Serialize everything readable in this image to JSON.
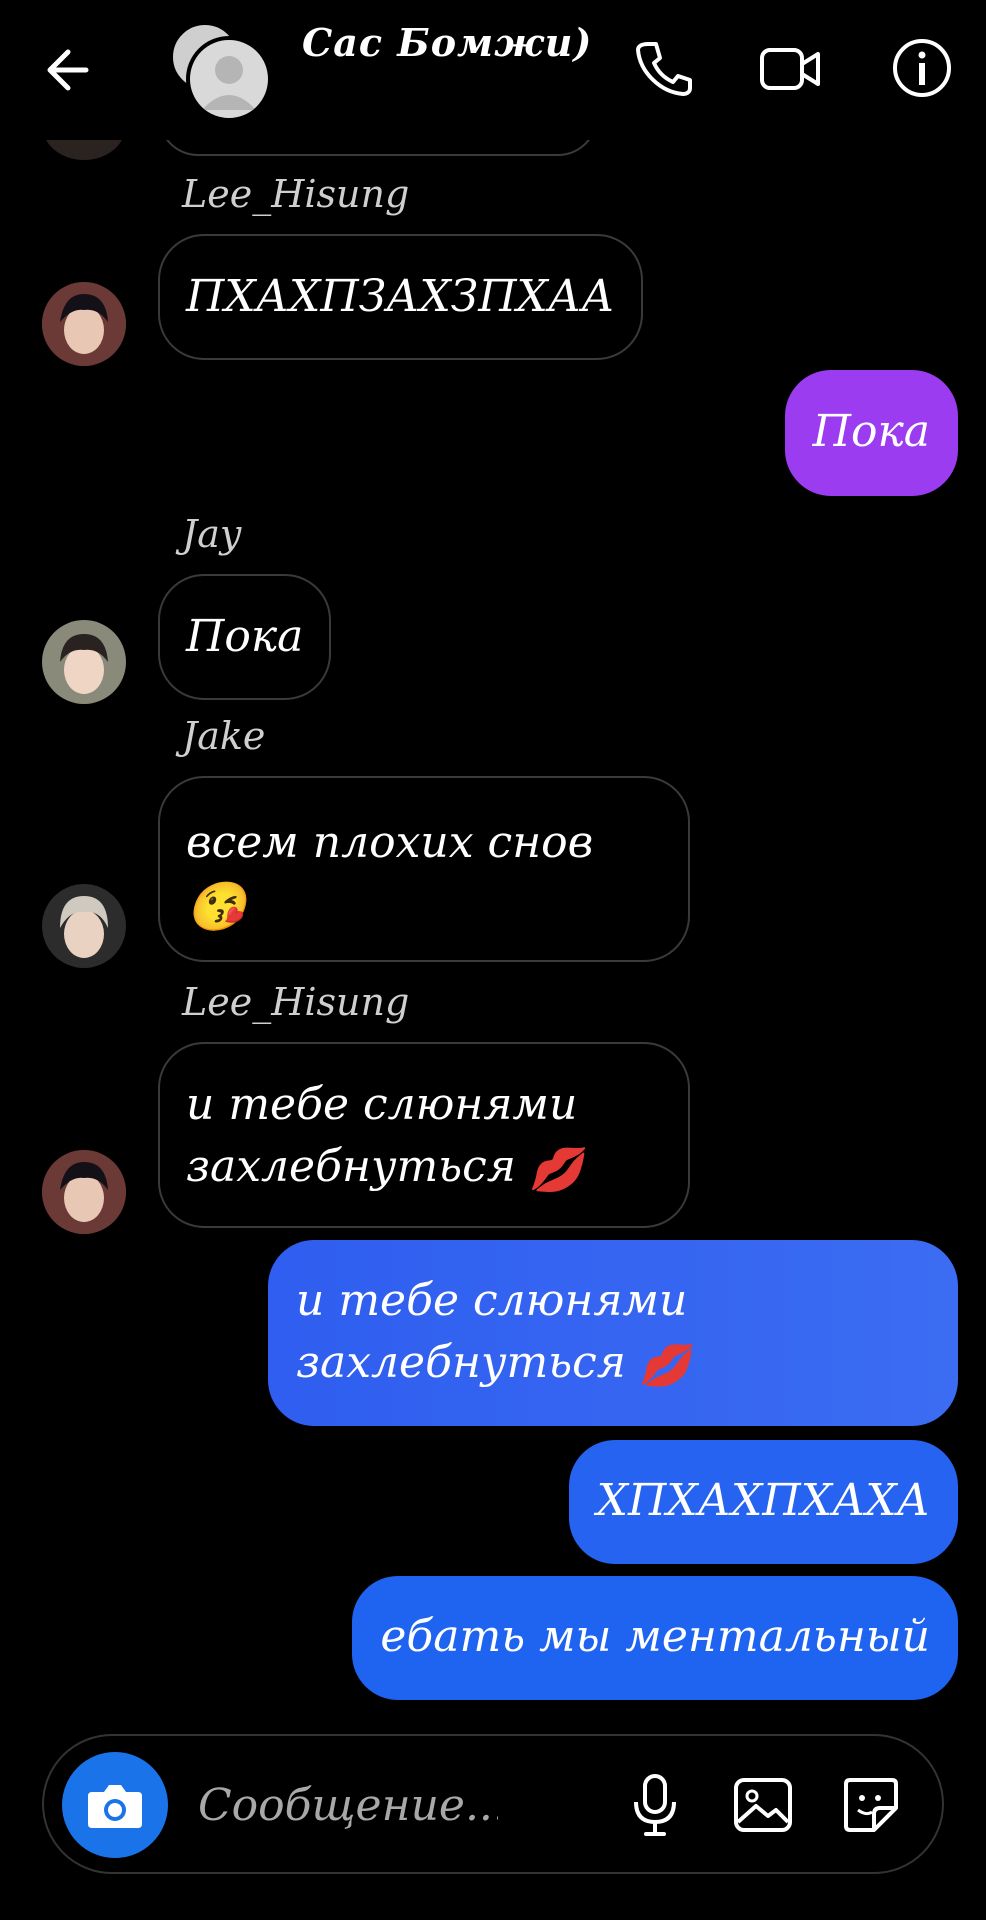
{
  "header": {
    "title": "Сас Бомжи)"
  },
  "messages": [
    {
      "sender": "Lee_Hisung",
      "text": "ПХАХПЗАХЗПХАА"
    },
    {
      "text": "Пока",
      "color": "#9b3cf0"
    },
    {
      "sender": "Jay",
      "text": "Пока"
    },
    {
      "sender": "Jake",
      "line1": "всем плохих снов",
      "emoji": "😘"
    },
    {
      "sender": "Lee_Hisung",
      "line1": "и тебе слюнями",
      "line2": "захлебнуться",
      "emoji": "💋"
    },
    {
      "line1": "и тебе слюнями",
      "line2": "захлебнуться",
      "emoji": "💋",
      "color": "#2f62f0"
    },
    {
      "text": "ХПХАХПХАХА",
      "color": "#2563f0"
    },
    {
      "text": "ебать мы ментальный",
      "color": "#1f64f0"
    }
  ],
  "composer": {
    "placeholder": "Сообщение..."
  },
  "colors": {
    "accent": "#1a73e8",
    "incoming_border": "#3a3a3a",
    "purple_bubble": "#9b3cf0",
    "blue_bubble": "#2563f0"
  }
}
